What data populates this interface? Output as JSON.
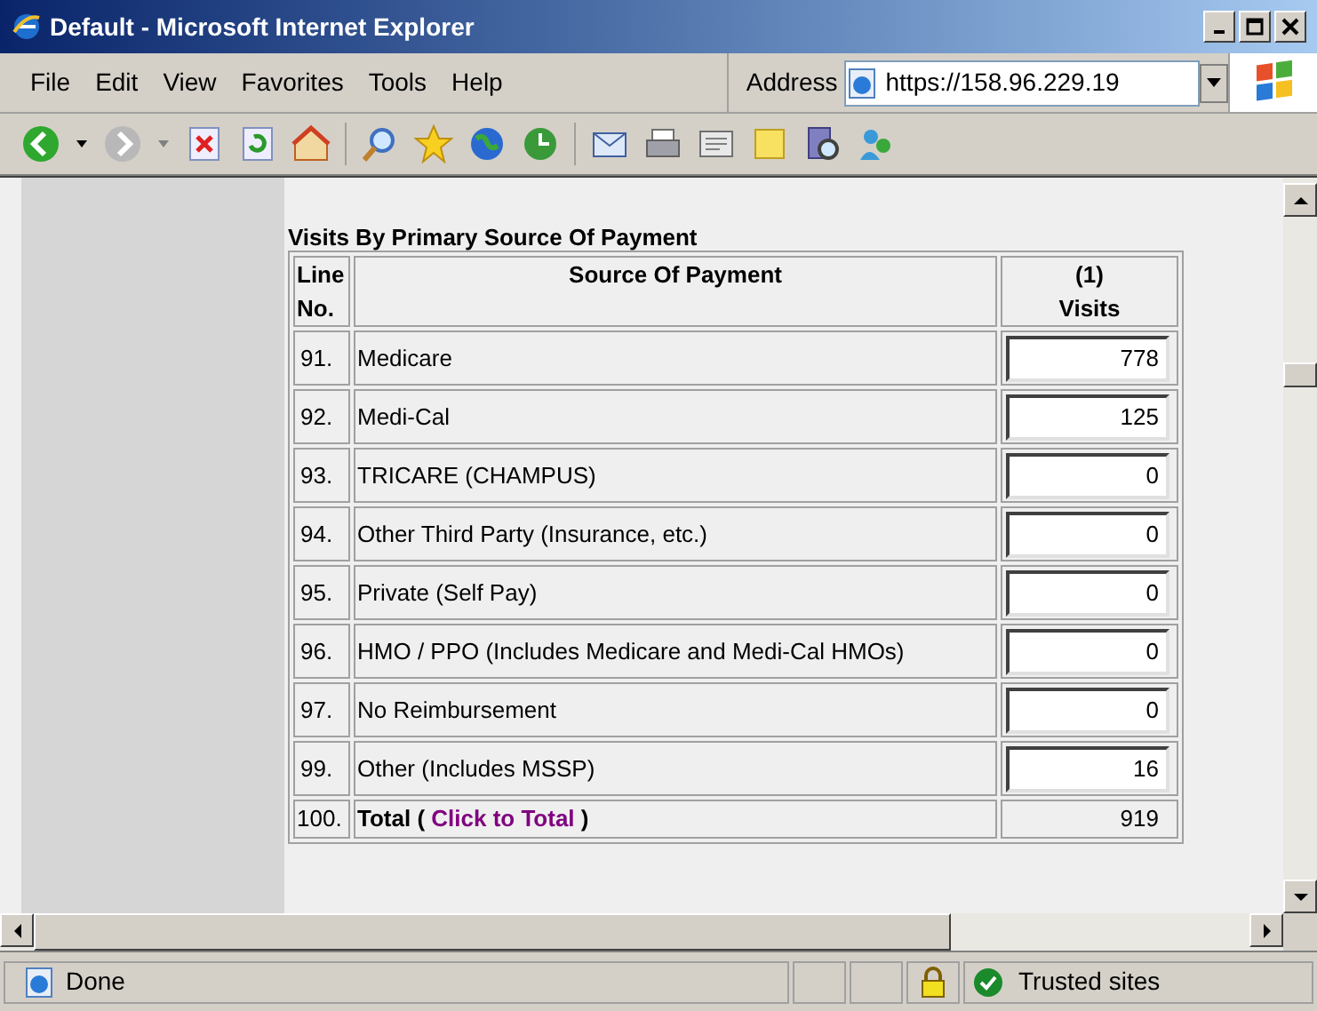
{
  "window": {
    "title": "Default - Microsoft Internet Explorer"
  },
  "menu": [
    "File",
    "Edit",
    "View",
    "Favorites",
    "Tools",
    "Help"
  ],
  "address": {
    "label": "Address",
    "value": "https://158.96.229.19"
  },
  "page": {
    "heading": "Visits By Primary Source Of Payment",
    "columns": [
      {
        "lines": [
          "Line",
          "No."
        ]
      },
      {
        "lines": [
          "Source Of Payment"
        ]
      },
      {
        "lines": [
          "(1)",
          "Visits"
        ]
      }
    ],
    "rows": [
      {
        "line": "91.",
        "source": "Medicare",
        "visits": "778"
      },
      {
        "line": "92.",
        "source": "Medi-Cal",
        "visits": "125"
      },
      {
        "line": "93.",
        "source": "TRICARE (CHAMPUS)",
        "visits": "0"
      },
      {
        "line": "94.",
        "source": "Other Third Party (Insurance, etc.)",
        "visits": "0"
      },
      {
        "line": "95.",
        "source": "Private (Self Pay)",
        "visits": "0"
      },
      {
        "line": "96.",
        "source": "HMO / PPO (Includes Medicare and Medi-Cal HMOs)",
        "visits": "0"
      },
      {
        "line": "97.",
        "source": "No Reimbursement",
        "visits": "0"
      },
      {
        "line": "99.",
        "source": "Other (Includes MSSP)",
        "visits": "16"
      }
    ],
    "total": {
      "line": "100.",
      "label_before": "Total (",
      "link": "Click to Total",
      "label_after": ")",
      "value": "919"
    }
  },
  "status_bar": {
    "text": "Done",
    "zone": "Trusted sites"
  }
}
